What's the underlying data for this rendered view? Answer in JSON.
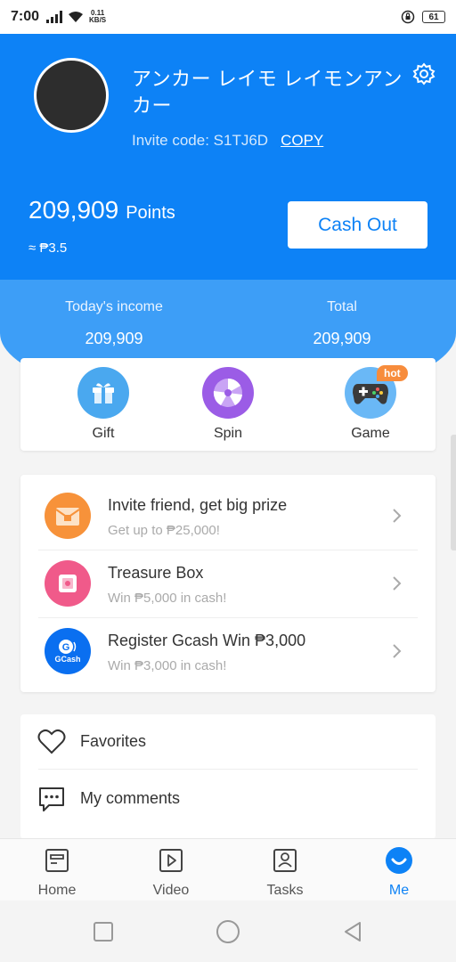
{
  "status_bar": {
    "time": "7:00",
    "net_speed_value": "0.11",
    "net_speed_unit": "KB/S",
    "battery": "61"
  },
  "profile": {
    "name": "アンカー レイモ レイモンアンカー",
    "invite_label": "Invite code: S1TJ6D",
    "copy_label": "COPY",
    "points_value": "209,909",
    "points_unit": "Points",
    "approx_value": "≈ ₱3.5",
    "cashout_label": "Cash Out"
  },
  "income": {
    "today_label": "Today's income",
    "today_value": "209,909",
    "total_label": "Total",
    "total_value": "209,909"
  },
  "quick_actions": [
    {
      "label": "Gift",
      "icon": "gift-icon",
      "color": "#4aa8ef"
    },
    {
      "label": "Spin",
      "icon": "spin-wheel-icon",
      "color": "#9b5ce6"
    },
    {
      "label": "Game",
      "icon": "gamepad-icon",
      "color": "#3e9ff1",
      "badge": "hot"
    }
  ],
  "promos": [
    {
      "title": "Invite friend, get big prize",
      "subtitle": "Get up to ₱25,000!",
      "icon": "envelope-icon",
      "color": "#f7923a"
    },
    {
      "title": "Treasure Box",
      "subtitle": "Win ₱5,000 in cash!",
      "icon": "treasure-box-icon",
      "color": "#f05a8a"
    },
    {
      "title": "Register Gcash Win ₱3,000",
      "subtitle": "Win ₱3,000 in cash!",
      "icon": "gcash-icon",
      "color": "#0a6ff0",
      "icon_text": "GCash"
    }
  ],
  "menu": [
    {
      "label": "Favorites",
      "icon": "heart-icon"
    },
    {
      "label": "My comments",
      "icon": "comment-icon"
    }
  ],
  "tabs": [
    {
      "label": "Home",
      "icon": "home-icon"
    },
    {
      "label": "Video",
      "icon": "video-icon"
    },
    {
      "label": "Tasks",
      "icon": "tasks-icon"
    },
    {
      "label": "Me",
      "icon": "me-icon",
      "active": true
    }
  ],
  "colors": {
    "primary": "#0d82f6",
    "band": "#3d9ef7",
    "hot_badge": "#f78c3c"
  }
}
